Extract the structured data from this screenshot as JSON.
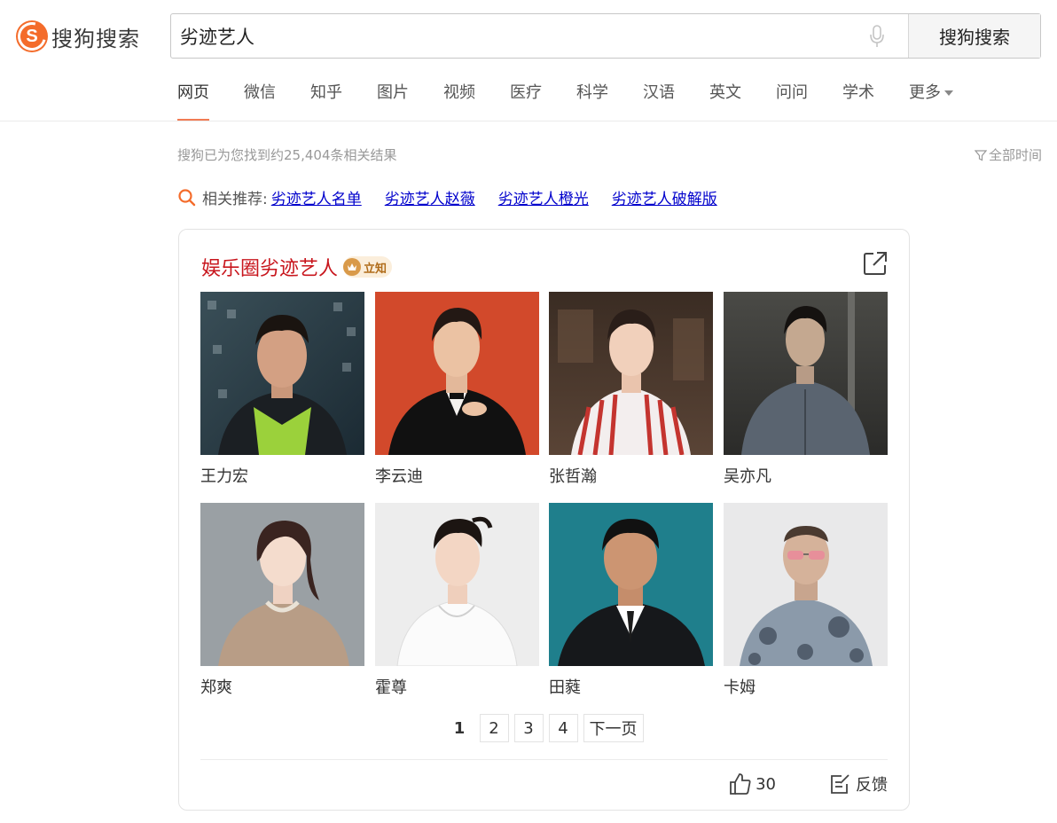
{
  "header": {
    "logo_text": "搜狗搜索",
    "query": "劣迹艺人",
    "search_button": "搜狗搜索"
  },
  "nav": {
    "items": [
      "网页",
      "微信",
      "知乎",
      "图片",
      "视频",
      "医疗",
      "科学",
      "汉语",
      "英文",
      "问问",
      "学术"
    ],
    "more": "更多",
    "active_index": 0
  },
  "results": {
    "count_text": "搜狗已为您找到约25,404条相关结果",
    "time_filter": "全部时间"
  },
  "related": {
    "label": "相关推荐:",
    "links": [
      "劣迹艺人名单",
      "劣迹艺人赵薇",
      "劣迹艺人橙光",
      "劣迹艺人破解版"
    ]
  },
  "card": {
    "title": "娱乐圈劣迹艺人",
    "badge": "立知",
    "people": [
      {
        "name": "王力宏"
      },
      {
        "name": "李云迪"
      },
      {
        "name": "张哲瀚"
      },
      {
        "name": "吴亦凡"
      },
      {
        "name": "郑爽"
      },
      {
        "name": "霍尊"
      },
      {
        "name": "田蕤"
      },
      {
        "name": "卡姆"
      }
    ],
    "pages": [
      "1",
      "2",
      "3",
      "4"
    ],
    "next_page": "下一页",
    "like_count": "30",
    "feedback": "反馈"
  },
  "colors": {
    "brand": "#f46c2b",
    "title_red": "#c8161d",
    "link_blue": "#0000cc",
    "nav_underline": "#f17b54"
  }
}
